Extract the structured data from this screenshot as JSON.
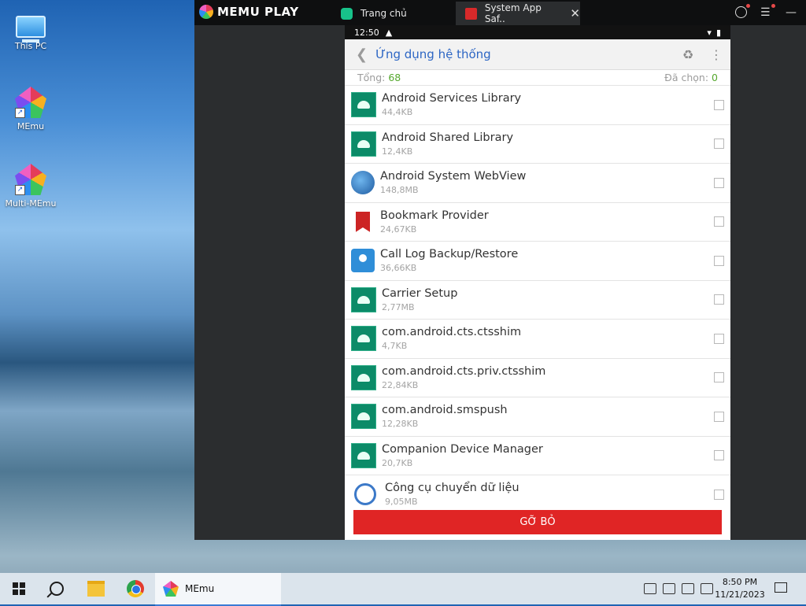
{
  "desktop": {
    "icons": [
      {
        "label": "This PC"
      },
      {
        "label": "MEmu"
      },
      {
        "label": "Multi-MEmu"
      }
    ]
  },
  "emulator": {
    "brand": "MEMU PLAY",
    "tabs": [
      {
        "label": "Trang chủ",
        "icon": "memu-home-icon"
      },
      {
        "label": "System App Saf..",
        "icon": "system-app-icon"
      }
    ],
    "android": {
      "status": {
        "time": "12:50",
        "warning": "▲"
      },
      "app_title": "Ứng dụng hệ thống",
      "summary": {
        "total_label": "Tổng:",
        "total_value": "68",
        "selected_label": "Đã chọn:",
        "selected_value": "0"
      },
      "apps": [
        {
          "name": "Android Services Library",
          "size": "44,4KB",
          "icon": "android-icon"
        },
        {
          "name": "Android Shared Library",
          "size": "12,4KB",
          "icon": "android-icon"
        },
        {
          "name": "Android System WebView",
          "size": "148,8MB",
          "icon": "globe-icon"
        },
        {
          "name": "Bookmark Provider",
          "size": "24,67KB",
          "icon": "bookmark-icon"
        },
        {
          "name": "Call Log Backup/Restore",
          "size": "36,66KB",
          "icon": "contact-card-icon"
        },
        {
          "name": "Carrier Setup",
          "size": "2,77MB",
          "icon": "android-icon"
        },
        {
          "name": "com.android.cts.ctsshim",
          "size": "4,7KB",
          "icon": "android-icon"
        },
        {
          "name": "com.android.cts.priv.ctsshim",
          "size": "22,84KB",
          "icon": "android-icon"
        },
        {
          "name": "com.android.smspush",
          "size": "12,28KB",
          "icon": "android-icon"
        },
        {
          "name": "Companion Device Manager",
          "size": "20,7KB",
          "icon": "android-icon"
        },
        {
          "name": "Công cụ chuyển dữ liệu",
          "size": "9,05MB",
          "icon": "history-icon"
        }
      ],
      "uninstall_label": "GỠ BỎ",
      "accent_colors": {
        "title": "#2d66c4",
        "count": "#56a82e",
        "button": "#e02525"
      }
    }
  },
  "taskbar": {
    "memu_label": "MEmu",
    "time": "8:50 PM",
    "date": "11/21/2023"
  }
}
